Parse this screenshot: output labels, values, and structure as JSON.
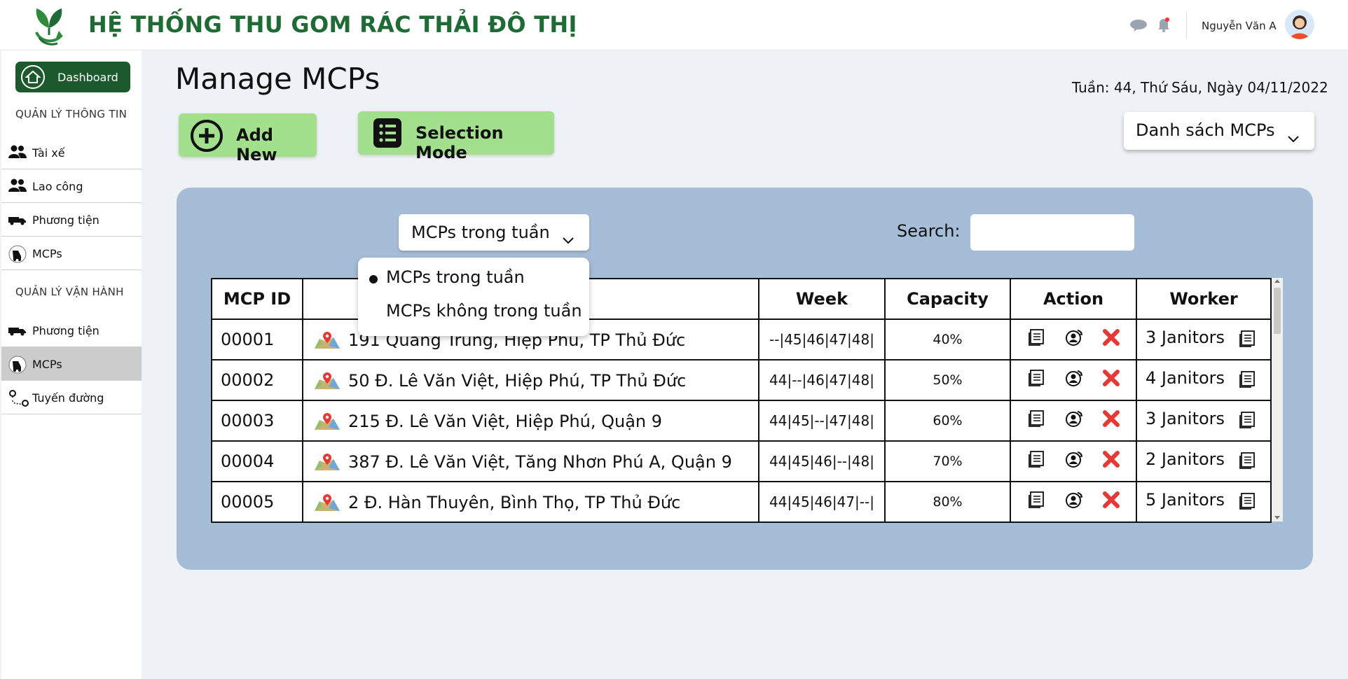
{
  "header": {
    "app_title": "HỆ THỐNG THU GOM RÁC THẢI ĐÔ THỊ",
    "user_name": "Nguyễn Văn A",
    "brand_color": "#1f6b35"
  },
  "sidebar": {
    "dashboard_label": "Dashboard",
    "section_info": "QUẢN LÝ THÔNG TIN",
    "info_items": [
      {
        "label": "Tài xế",
        "icon": "users-icon"
      },
      {
        "label": "Lao công",
        "icon": "users-icon"
      },
      {
        "label": "Phương tiện",
        "icon": "truck-icon"
      },
      {
        "label": "MCPs",
        "icon": "bin-icon"
      }
    ],
    "section_ops": "QUẢN LÝ VẬN HÀNH",
    "ops_items": [
      {
        "label": "Phương tiện",
        "icon": "truck-icon"
      },
      {
        "label": "MCPs",
        "icon": "bin-icon",
        "active": true
      },
      {
        "label": "Tuyến đường",
        "icon": "route-icon"
      }
    ]
  },
  "main": {
    "page_title": "Manage MCPs",
    "week_info": "Tuần: 44, Thứ Sáu, Ngày 04/11/2022",
    "add_new_label": "Add New",
    "selection_mode_label": "Selection Mode",
    "list_select": "Danh sách MCPs",
    "filter_select": "MCPs trong tuần",
    "filter_options": [
      "MCPs trong tuần",
      "MCPs không trong tuần"
    ],
    "search_label": "Search:",
    "search_value": ""
  },
  "table": {
    "headers": [
      "MCP ID",
      "",
      "Week",
      "Capacity",
      "Action",
      "Worker"
    ],
    "rows": [
      {
        "id": "00001",
        "address": "191 Quang Trung, Hiệp Phú, TP Thủ Đức",
        "week": "--|45|46|47|48|",
        "capacity": "40%",
        "worker": "3 Janitors"
      },
      {
        "id": "00002",
        "address": "50 Đ. Lê Văn Việt, Hiệp Phú, TP Thủ Đức",
        "week": "44|--|46|47|48|",
        "capacity": "50%",
        "worker": "4 Janitors"
      },
      {
        "id": "00003",
        "address": "215 Đ. Lê Văn Việt, Hiệp Phú, Quận 9",
        "week": "44|45|--|47|48|",
        "capacity": "60%",
        "worker": "3 Janitors"
      },
      {
        "id": "00004",
        "address": "387 Đ. Lê Văn Việt, Tăng Nhơn Phú A, Quận 9",
        "week": "44|45|46|--|48|",
        "capacity": "70%",
        "worker": "2 Janitors"
      },
      {
        "id": "00005",
        "address": "2 Đ. Hàn Thuyên, Bình Thọ, TP Thủ Đức",
        "week": "44|45|46|47|--|",
        "capacity": "80%",
        "worker": "5 Janitors"
      }
    ]
  },
  "colors": {
    "accent_green": "#a3e08e",
    "panel_blue": "#a6bdd8",
    "delete_red": "#e53935",
    "sidebar_active": "#cccccc"
  }
}
